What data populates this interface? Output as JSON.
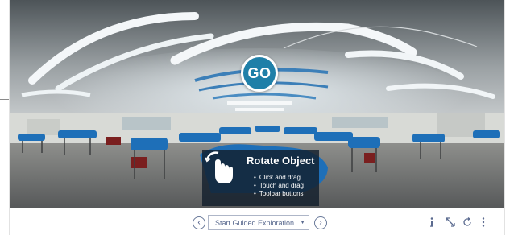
{
  "panorama": {
    "alt": "Panoramic view of an anatomy lab with tables covered in blue sheets",
    "go_label": "GO"
  },
  "rotate_help": {
    "title": "Rotate Object",
    "items": [
      "Click and drag",
      "Touch and drag",
      "Toolbar buttons"
    ]
  },
  "toolbar": {
    "prev_symbol": "‹",
    "next_symbol": "›",
    "guided_label": "Start Guided Exploration",
    "caret": "▼"
  },
  "icons": {
    "info": "info-icon",
    "expand": "expand-icon",
    "reset": "reset-icon",
    "more": "more-icon"
  },
  "colors": {
    "go_button": "#1f7fa8",
    "sheet_blue": "#1e6fb8",
    "toolbar_text": "#5a6a8f"
  }
}
